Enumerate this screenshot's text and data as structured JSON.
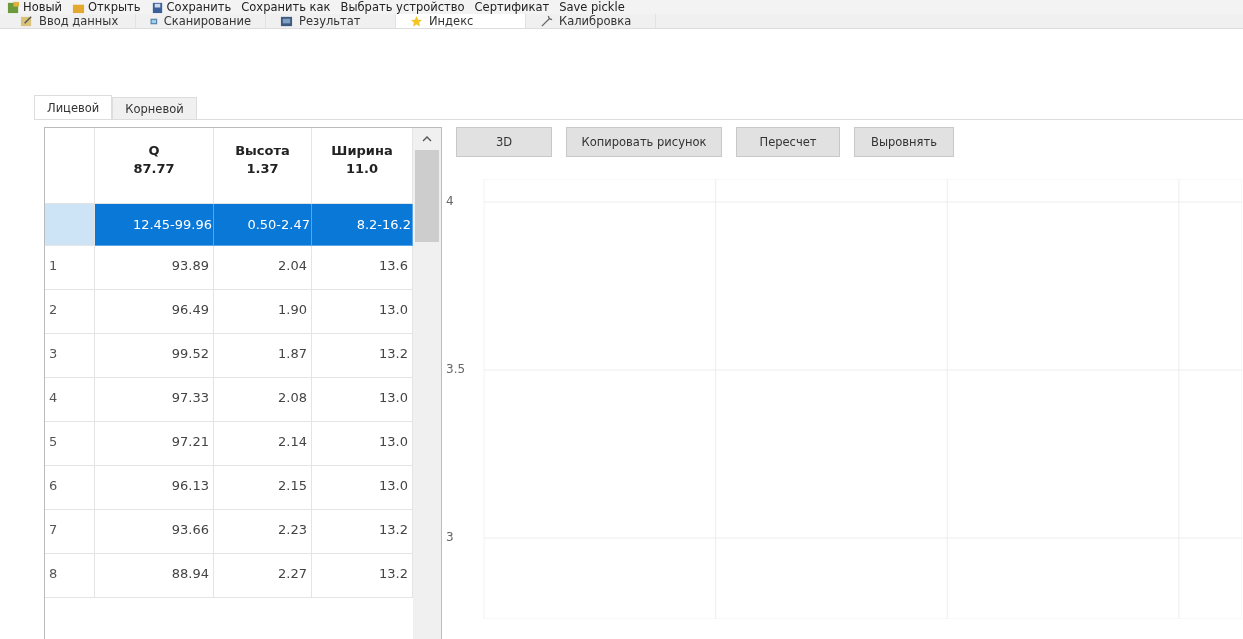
{
  "toolbar": [
    {
      "label": "Новый",
      "kind": "new"
    },
    {
      "label": "Открыть",
      "kind": "open"
    },
    {
      "label": "Сохранить",
      "kind": "save"
    },
    {
      "label": "Сохранить как",
      "kind": "text"
    },
    {
      "label": "Выбрать устройство",
      "kind": "text"
    },
    {
      "label": "Сертификат",
      "kind": "text"
    },
    {
      "label": "Save pickle",
      "kind": "text"
    }
  ],
  "tabs": [
    {
      "label": "Ввод данных",
      "kind": "edit",
      "selected": false
    },
    {
      "label": "Сканирование",
      "kind": "scan",
      "selected": false
    },
    {
      "label": "Результат",
      "kind": "result",
      "selected": false
    },
    {
      "label": "Индекс",
      "kind": "star",
      "selected": true
    },
    {
      "label": "Калибровка",
      "kind": "wand",
      "selected": false
    }
  ],
  "subtabs": [
    {
      "label": "Лицевой",
      "selected": true
    },
    {
      "label": "Корневой",
      "selected": false
    }
  ],
  "table": {
    "columns": [
      {
        "name": "Q",
        "value": "87.77"
      },
      {
        "name": "Высота",
        "value": "1.37"
      },
      {
        "name": "Ширина",
        "value": "11.0"
      }
    ],
    "range_row": {
      "cells": [
        "12.45-99.96",
        "0.50-2.47",
        "8.2-16.2"
      ],
      "selected": true
    },
    "rows": [
      {
        "index": "1",
        "cells": [
          "93.89",
          "2.04",
          "13.6"
        ]
      },
      {
        "index": "2",
        "cells": [
          "96.49",
          "1.90",
          "13.0"
        ]
      },
      {
        "index": "3",
        "cells": [
          "99.52",
          "1.87",
          "13.2"
        ]
      },
      {
        "index": "4",
        "cells": [
          "97.33",
          "2.08",
          "13.0"
        ]
      },
      {
        "index": "5",
        "cells": [
          "97.21",
          "2.14",
          "13.0"
        ]
      },
      {
        "index": "6",
        "cells": [
          "96.13",
          "2.15",
          "13.0"
        ]
      },
      {
        "index": "7",
        "cells": [
          "93.66",
          "2.23",
          "13.2"
        ]
      },
      {
        "index": "8",
        "cells": [
          "88.94",
          "2.27",
          "13.2"
        ]
      }
    ]
  },
  "buttons": [
    "3D",
    "Копировать рисунок",
    "Пересчет",
    "Выровнять"
  ],
  "plot": {
    "y_ticks": [
      "4",
      "3.5",
      "3"
    ]
  }
}
